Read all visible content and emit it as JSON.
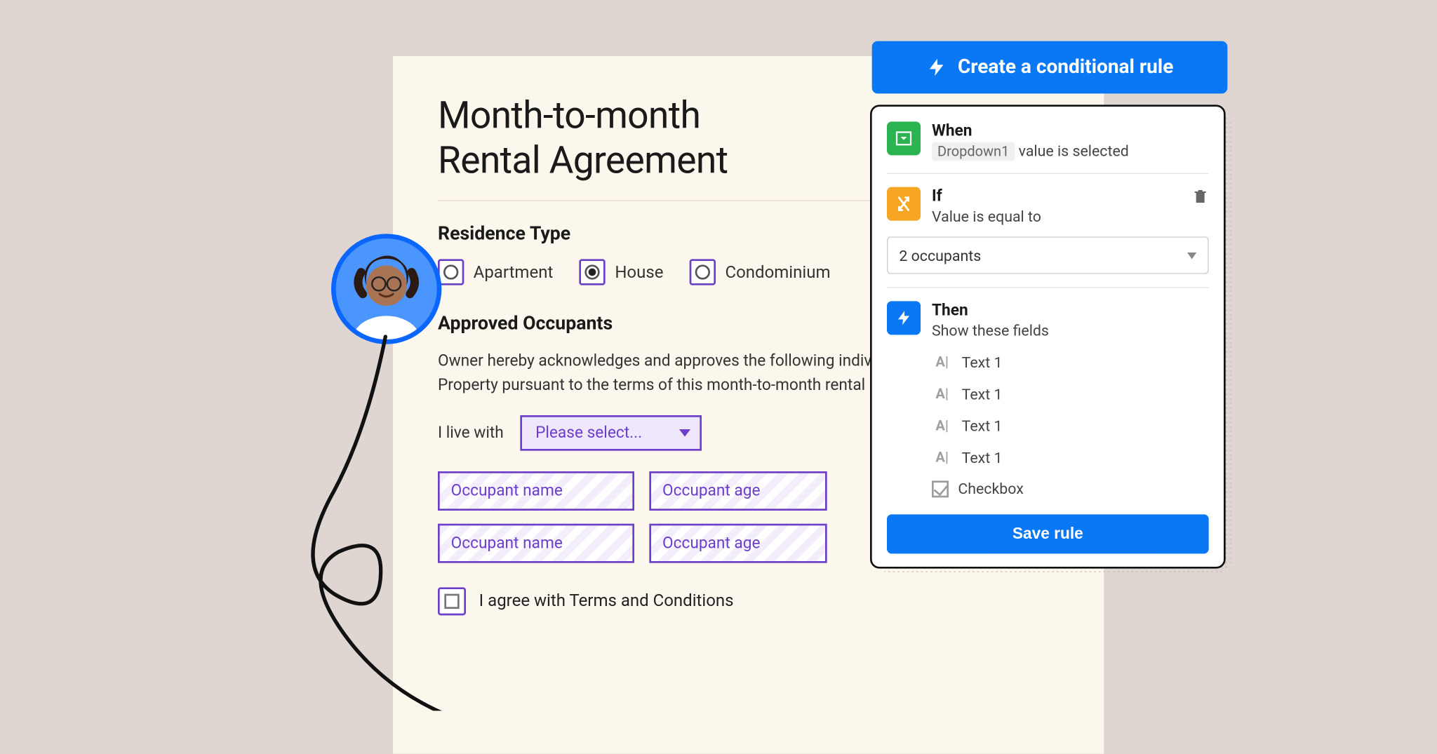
{
  "doc": {
    "title_l1": "Month-to-month",
    "title_l2": "Rental Agreement",
    "section_residence": "Residence Type",
    "section_occupants": "Approved Occupants",
    "residence_options": [
      "Apartment",
      "House",
      "Condominium"
    ],
    "residence_selected_index": 1,
    "occupants_paragraph": "Owner hereby acknowledges and approves the following individuals for residence at the Property pursuant to the terms of this month-to-month rental agreement:",
    "live_with_label": "I live with",
    "dropdown_placeholder": "Please select...",
    "occupant_fields": [
      [
        "Occupant name",
        "Occupant age"
      ],
      [
        "Occupant name",
        "Occupant age"
      ]
    ],
    "terms_label": "I agree with Terms and Conditions"
  },
  "create_button": "Create a conditional rule",
  "rule": {
    "when": {
      "label": "When",
      "pill": "Dropdown1",
      "suffix": "value is selected"
    },
    "if": {
      "label": "If",
      "sub": "Value is equal to",
      "select_value": "2 occupants"
    },
    "then": {
      "label": "Then",
      "sub": "Show these fields",
      "fields": [
        {
          "type": "text",
          "label": "Text 1"
        },
        {
          "type": "text",
          "label": "Text 1"
        },
        {
          "type": "text",
          "label": "Text 1"
        },
        {
          "type": "text",
          "label": "Text 1"
        },
        {
          "type": "check",
          "label": "Checkbox"
        }
      ]
    },
    "save": "Save rule"
  }
}
